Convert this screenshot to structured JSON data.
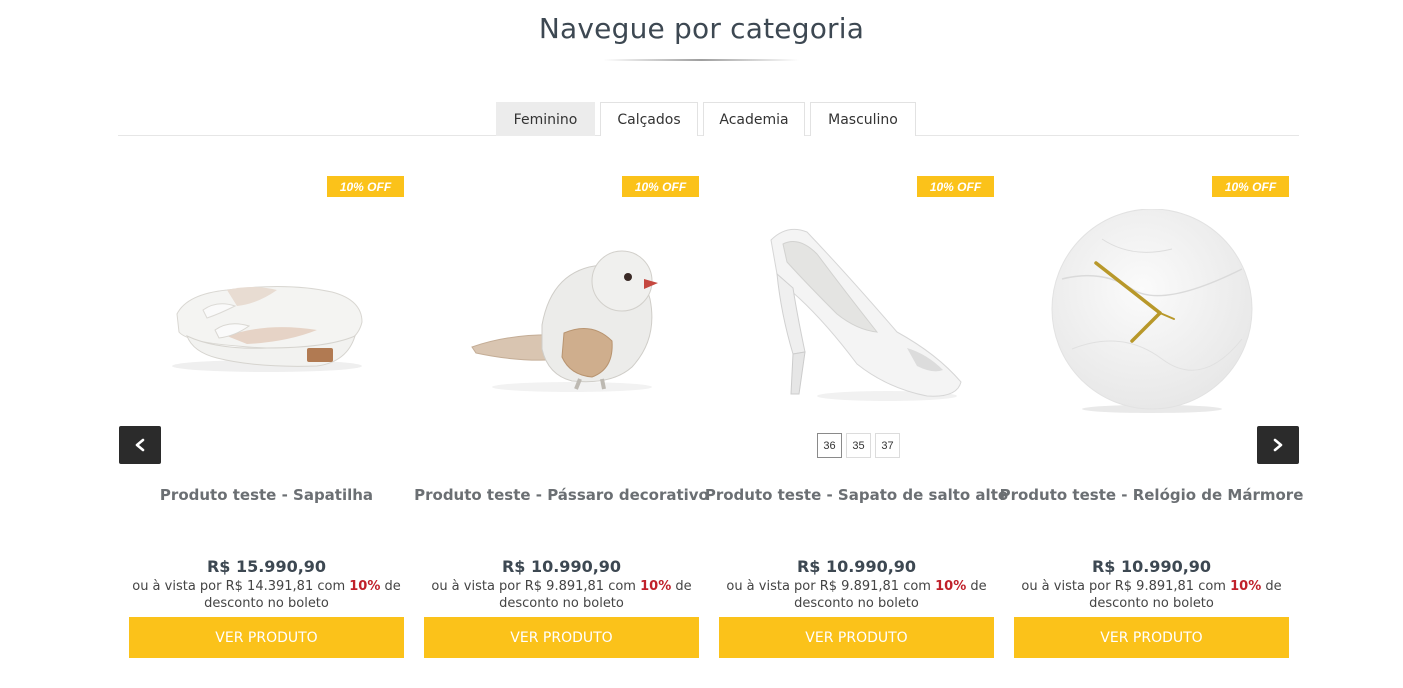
{
  "section": {
    "title": "Navegue por categoria"
  },
  "tabs": [
    {
      "label": "Feminino",
      "active": true
    },
    {
      "label": "Calçados",
      "active": false
    },
    {
      "label": "Academia",
      "active": false
    },
    {
      "label": "Masculino",
      "active": false
    }
  ],
  "carousel": {
    "prev_icon": "chevron-left-icon",
    "next_icon": "chevron-right-icon"
  },
  "products": [
    {
      "badge": "10% OFF",
      "name": "Produto teste - Sapatilha",
      "price": "R$ 15.990,90",
      "cash_prefix": "ou à vista por R$ 14.391,81 com",
      "discount": "10%",
      "cash_suffix": "de desconto no boleto",
      "button": "VER PRODUTO"
    },
    {
      "badge": "10% OFF",
      "name": "Produto teste - Pássaro decorativo",
      "price": "R$ 10.990,90",
      "cash_prefix": "ou à vista por R$ 9.891,81 com",
      "discount": "10%",
      "cash_suffix": "de desconto no boleto",
      "button": "VER PRODUTO"
    },
    {
      "badge": "10% OFF",
      "name": "Produto teste - Sapato de salto alto",
      "price": "R$ 10.990,90",
      "cash_prefix": "ou à vista por R$ 9.891,81 com",
      "discount": "10%",
      "cash_suffix": "de desconto no boleto",
      "button": "VER PRODUTO",
      "sizes": [
        "36",
        "35",
        "37"
      ],
      "selected_size": "36"
    },
    {
      "badge": "10% OFF",
      "name": "Produto teste - Relógio de Mármore",
      "price": "R$ 10.990,90",
      "cash_prefix": "ou à vista por R$ 9.891,81 com",
      "discount": "10%",
      "cash_suffix": "de desconto no boleto",
      "button": "VER PRODUTO"
    }
  ],
  "colors": {
    "accent": "#fbc21a",
    "discount": "#c0202a",
    "title": "#3d4852",
    "arrow_bg": "#2b2b2b"
  }
}
